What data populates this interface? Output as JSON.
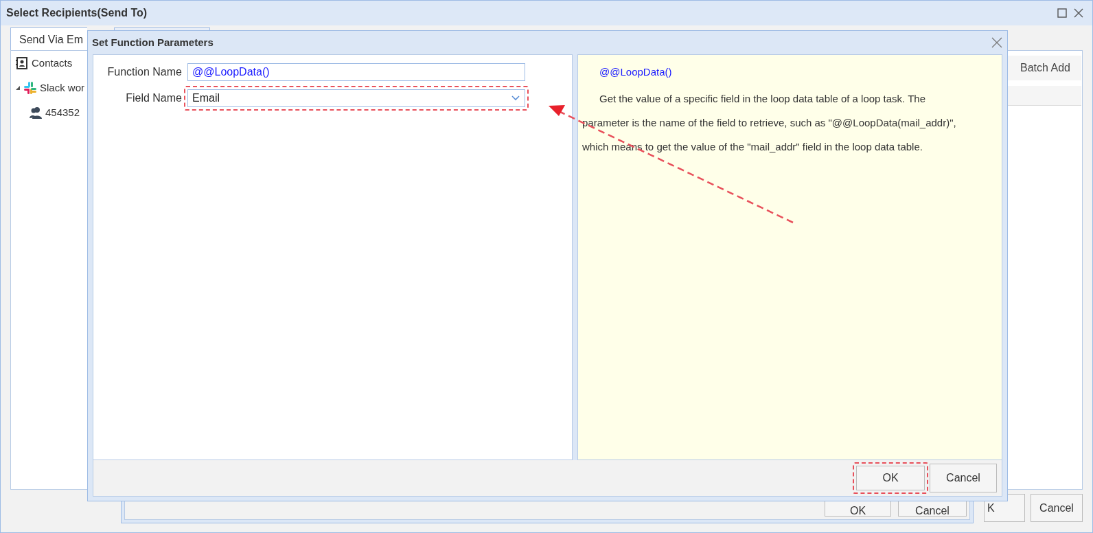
{
  "window": {
    "title": "Select Recipients(Send To)"
  },
  "tabs": [
    {
      "label": "Send Via Em",
      "selected": true
    },
    {
      "selected": false
    }
  ],
  "tree": [
    {
      "label": "Contacts",
      "kind": "contacts"
    },
    {
      "label": "Slack wor",
      "kind": "slack",
      "expanded": true,
      "children": [
        {
          "label": "454352",
          "kind": "users"
        }
      ]
    }
  ],
  "toolbar": {
    "button": "Batch Add"
  },
  "buttons": [
    "K",
    "Cancel"
  ],
  "back_dialog": {
    "buttons": [
      "OK",
      "Cancel"
    ]
  },
  "dialog": {
    "title": "Set Function Parameters",
    "fields": [
      {
        "label": "Function Name",
        "value": "@@LoopData()",
        "kind": "text"
      },
      {
        "label": "Field Name",
        "value": "Email",
        "kind": "dropdown"
      }
    ],
    "help": {
      "title": "@@LoopData()",
      "text": "Get the value of a specific field in the loop data table of a loop task. The parameter is the name of the field to retrieve, such as \"@@LoopData(mail_addr)\", which means to get the value of the \"mail_addr\" field in the loop data table."
    },
    "buttons": [
      "OK",
      "Cancel"
    ]
  }
}
